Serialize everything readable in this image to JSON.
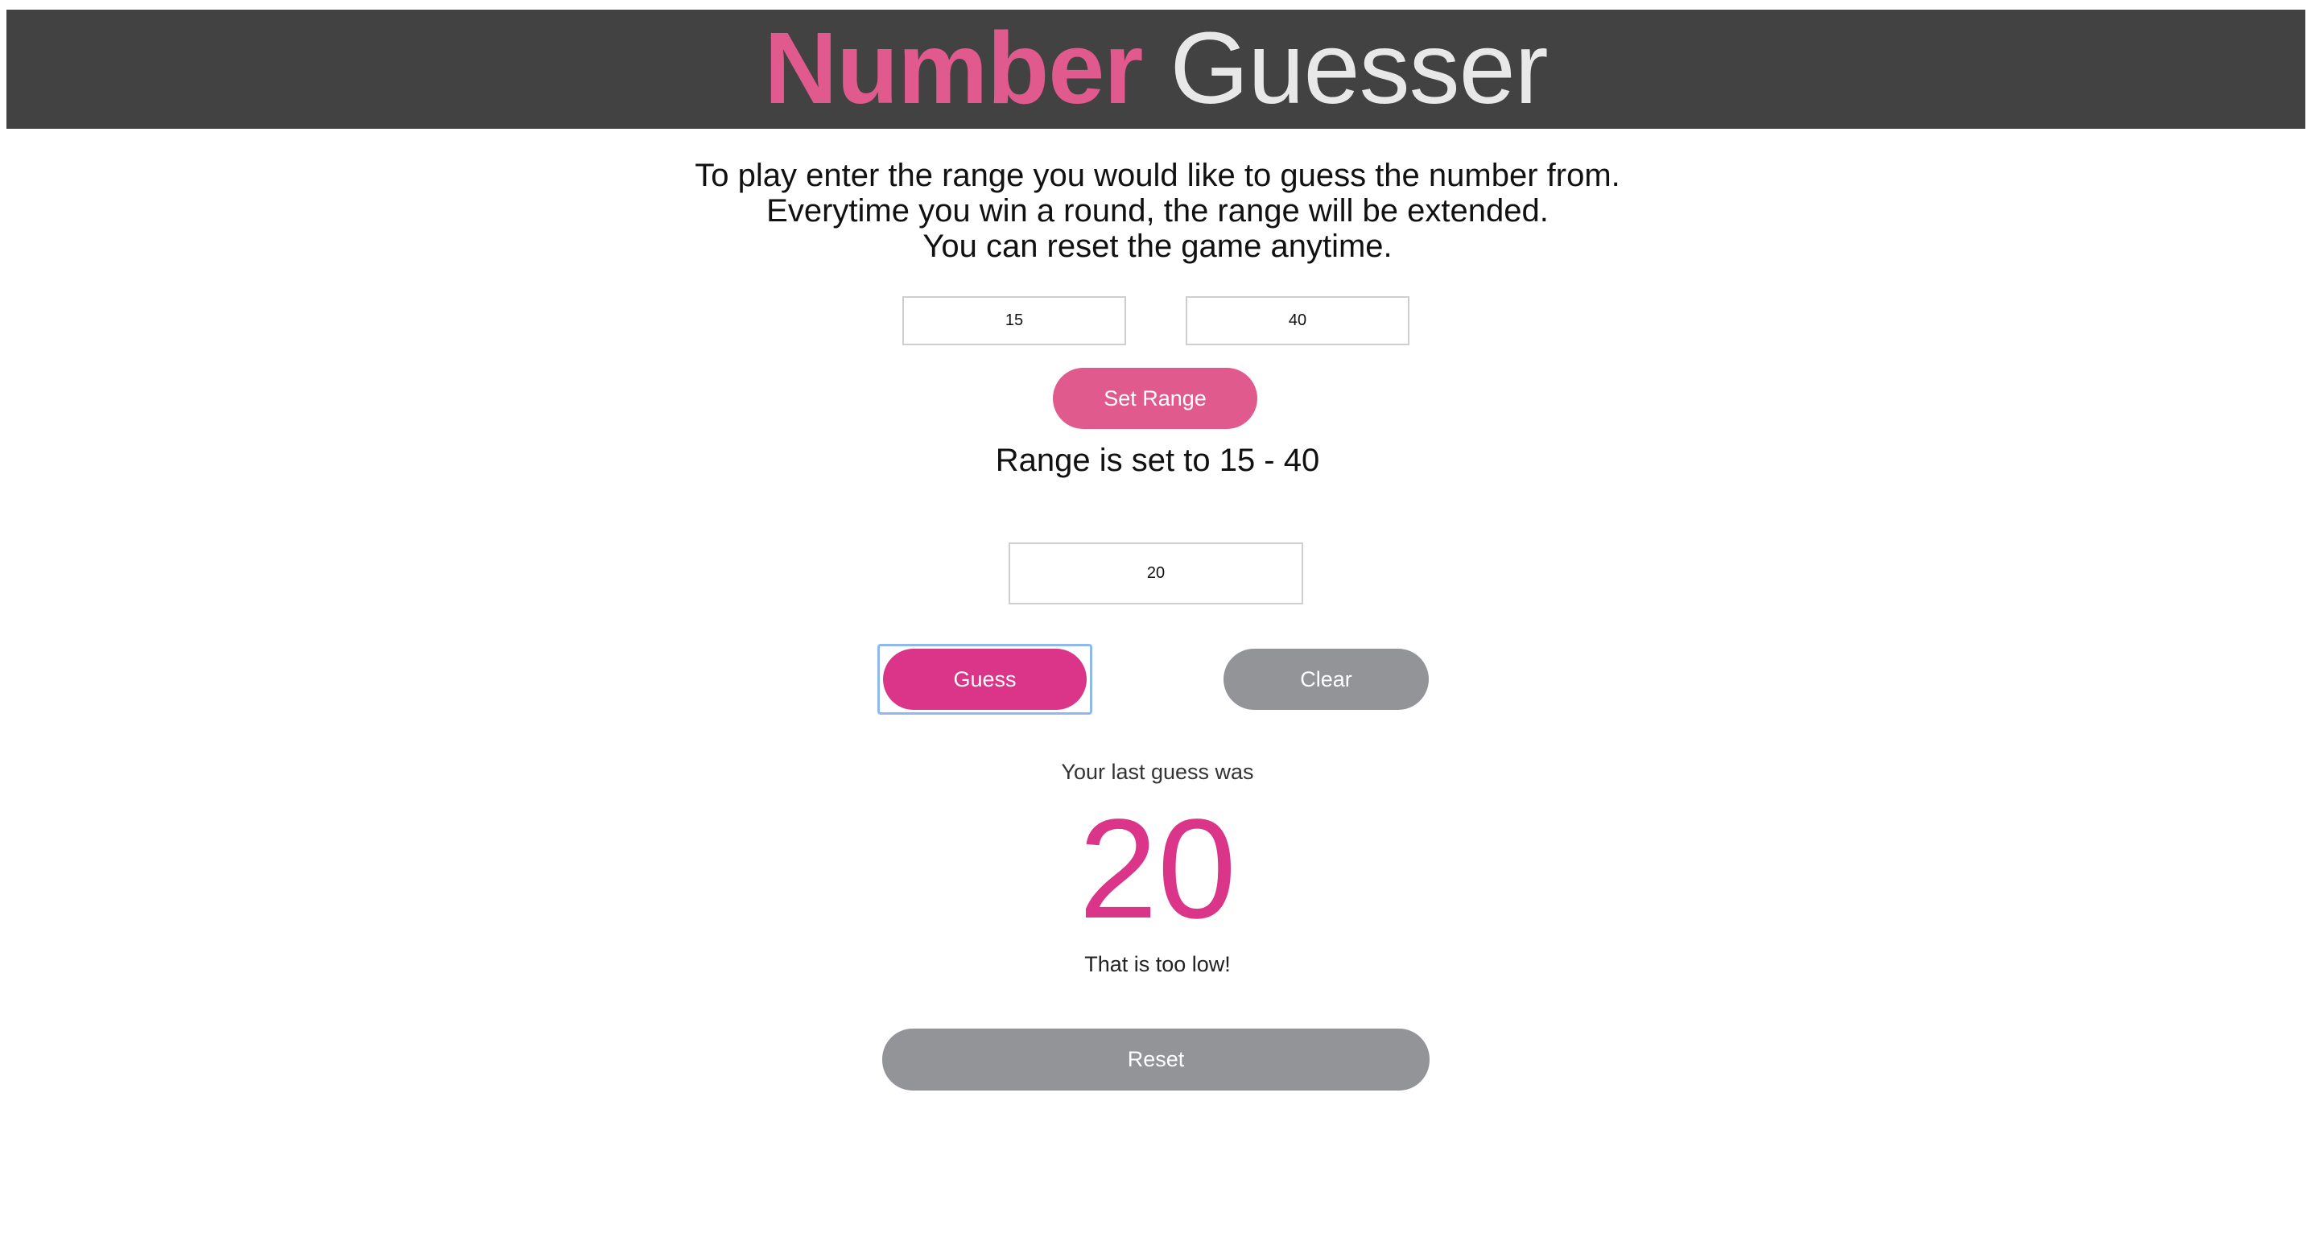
{
  "header": {
    "title_bold": "Number",
    "title_light": "Guesser"
  },
  "instructions": {
    "line1": "To play enter the range you would like to guess the number from.",
    "line2": "Everytime you win a round, the range will be extended.",
    "line3": "You can reset the game anytime."
  },
  "range": {
    "min_value": "15",
    "max_value": "40",
    "set_button_label": "Set Range",
    "status_text": "Range is set to 15 - 40"
  },
  "guess": {
    "input_value": "20",
    "guess_button_label": "Guess",
    "clear_button_label": "Clear"
  },
  "result": {
    "last_guess_label": "Your last guess was",
    "last_guess_value": "20",
    "feedback": "That is too low!"
  },
  "reset_button_label": "Reset",
  "colors": {
    "header_bg": "#424242",
    "accent_pink": "#e05a8d",
    "guess_pink": "#db3589",
    "button_gray": "#939498",
    "focus_ring": "#8fb8ee"
  }
}
